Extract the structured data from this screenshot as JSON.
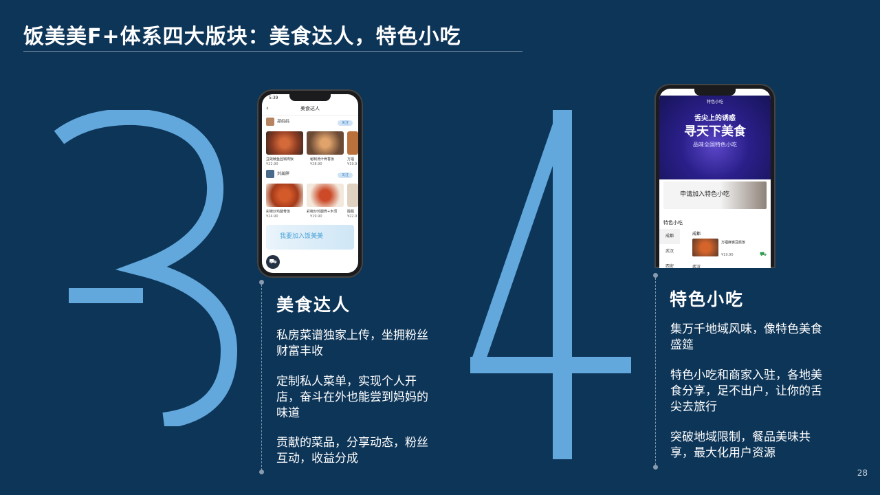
{
  "slide": {
    "title": "饭美美F+体系四大版块：美食达人，特色小吃",
    "page_number": "28",
    "big_numbers": [
      "3",
      "4"
    ]
  },
  "colors": {
    "background": "#0d3558",
    "big_number": "#62a8dc",
    "text": "#ffffff"
  },
  "phone1": {
    "status_time": "5:39",
    "nav_title": "美食达人",
    "users": [
      {
        "name": "郑妈妈",
        "follow": "关注"
      },
      {
        "name": "刘美胖",
        "follow": "关注"
      }
    ],
    "dishes_row1": [
      {
        "name": "豆豉鲮鱼回锅肉饭",
        "price": "¥22.90"
      },
      {
        "name": "秘制汤汁骨香饭",
        "price": "¥28.90"
      },
      {
        "name": "万福",
        "price": "¥19.9"
      }
    ],
    "dishes_row2": [
      {
        "name": "彩椒炒鸡腿骨饭",
        "price": "¥24.90"
      },
      {
        "name": "彩椒炒鸡腿骨+木须",
        "price": "¥19.90"
      },
      {
        "name": "酸甜",
        "price": "¥22.9"
      }
    ],
    "banner_text": "我要加入饭美美",
    "cart_icon": "cart-icon"
  },
  "phone2": {
    "status_time": "5:40",
    "nav_title": "特色小吃",
    "poster_line1": "舌尖上的诱惑",
    "poster_line2": "寻天下美食",
    "poster_line3": "品味全国特色小吃",
    "apply_title": "申请加入特色小吃",
    "section_label": "特色小吃",
    "cities": [
      "成都",
      "武汉",
      "西安"
    ],
    "region_label": "成都",
    "item_name": "万福麻婆豆腐饭",
    "item_price": "¥19.90",
    "region2_label": "武汉"
  },
  "section_food_expert": {
    "heading": "美食达人",
    "paragraphs": [
      "私房菜谱独家上传，坐拥粉丝财富丰收",
      "定制私人菜单，实现个人开店，奋斗在外也能尝到妈妈的味道",
      "贡献的菜品，分享动态，粉丝互动，收益分成"
    ]
  },
  "section_snacks": {
    "heading": "特色小吃",
    "paragraphs": [
      "集万千地域风味，像特色美食盛筵",
      "特色小吃和商家入驻，各地美食分享，足不出户，让你的舌尖去旅行",
      "突破地域限制，餐品美味共享，最大化用户资源"
    ]
  }
}
